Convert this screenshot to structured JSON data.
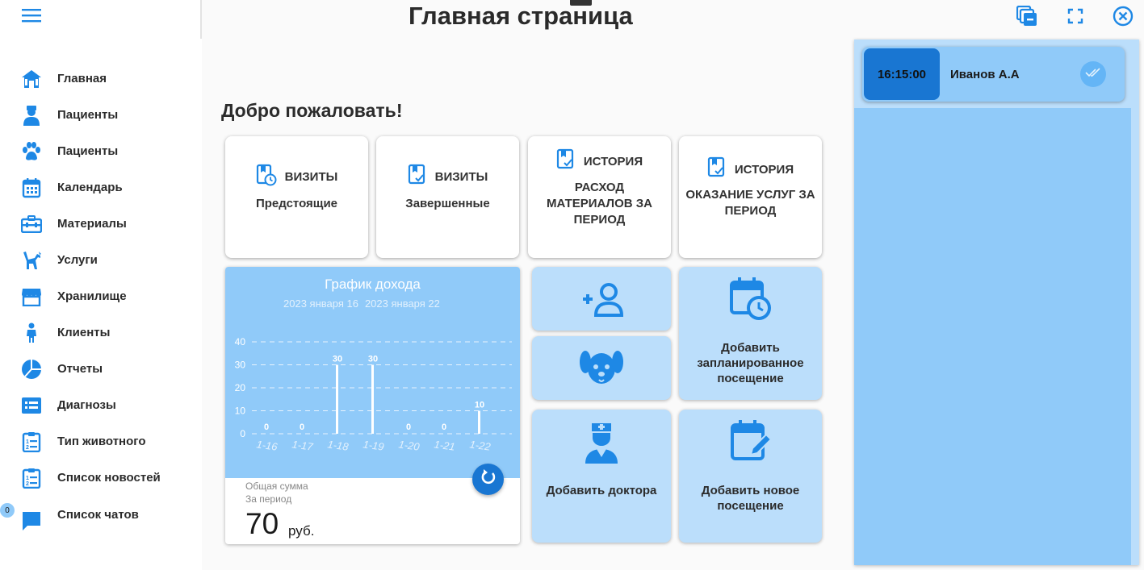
{
  "colors": {
    "accent": "#1e88e5",
    "accent_dark": "#1976d2",
    "light_blue": "#90caf9",
    "lighter_blue": "#bbdefb"
  },
  "header": {
    "title": "Главная страница"
  },
  "welcome": "Добро пожаловать!",
  "sidebar": {
    "items": [
      {
        "label": "Главная",
        "icon": "home-icon"
      },
      {
        "label": "Пациенты",
        "icon": "doctor-icon"
      },
      {
        "label": "Пациенты",
        "icon": "paw-icon"
      },
      {
        "label": "Календарь",
        "icon": "calendar-icon"
      },
      {
        "label": "Материалы",
        "icon": "toolbox-icon"
      },
      {
        "label": "Услуги",
        "icon": "grooming-icon"
      },
      {
        "label": "Хранилище",
        "icon": "store-icon"
      },
      {
        "label": "Клиенты",
        "icon": "person-icon"
      },
      {
        "label": "Отчеты",
        "icon": "pie-chart-icon"
      },
      {
        "label": "Диагнозы",
        "icon": "list-icon"
      },
      {
        "label": "Тип животного",
        "icon": "clipboard-list-icon"
      },
      {
        "label": "Список новостей",
        "icon": "clipboard-list-icon"
      },
      {
        "label": "Список чатов",
        "icon": "chat-icon"
      }
    ],
    "chat_badge": "0"
  },
  "cards": [
    {
      "kind": "ВИЗИТЫ",
      "sub": "Предстоящие"
    },
    {
      "kind": "ВИЗИТЫ",
      "sub": "Завершенные"
    },
    {
      "kind": "ИСТОРИЯ",
      "sub_lines": [
        "РАСХОД",
        "МАТЕРИАЛОВ ЗА",
        "ПЕРИОД"
      ]
    },
    {
      "kind": "ИСТОРИЯ",
      "sub_lines": [
        "ОКАЗАНИЕ УСЛУГ ЗА",
        "ПЕРИОД"
      ]
    }
  ],
  "chart_data": {
    "type": "bar",
    "title": "График дохода",
    "date_range": [
      "2023 января 16",
      "2023 января 22"
    ],
    "categories": [
      "1-16",
      "1-17",
      "1-18",
      "1-19",
      "1-20",
      "1-21",
      "1-22"
    ],
    "values": [
      0,
      0,
      30,
      30,
      0,
      0,
      10
    ],
    "y_ticks": [
      "0",
      "10",
      "20",
      "30",
      "40"
    ],
    "ylim": [
      0,
      40
    ],
    "grid": true
  },
  "totals": {
    "label1": "Общая сумма",
    "label2": "За период",
    "value": "70",
    "currency": "руб."
  },
  "tiles": {
    "add_client": "add-person-icon",
    "add_pet": "dog-icon",
    "add_scheduled_lines": [
      "Добавить",
      "запланированное",
      "посещение"
    ],
    "add_doctor": "Добавить доктора",
    "add_visit_lines": [
      "Добавить новое",
      "посещение"
    ]
  },
  "appointments": [
    {
      "time": "16:15:00",
      "name": "Иванов А.А"
    }
  ]
}
